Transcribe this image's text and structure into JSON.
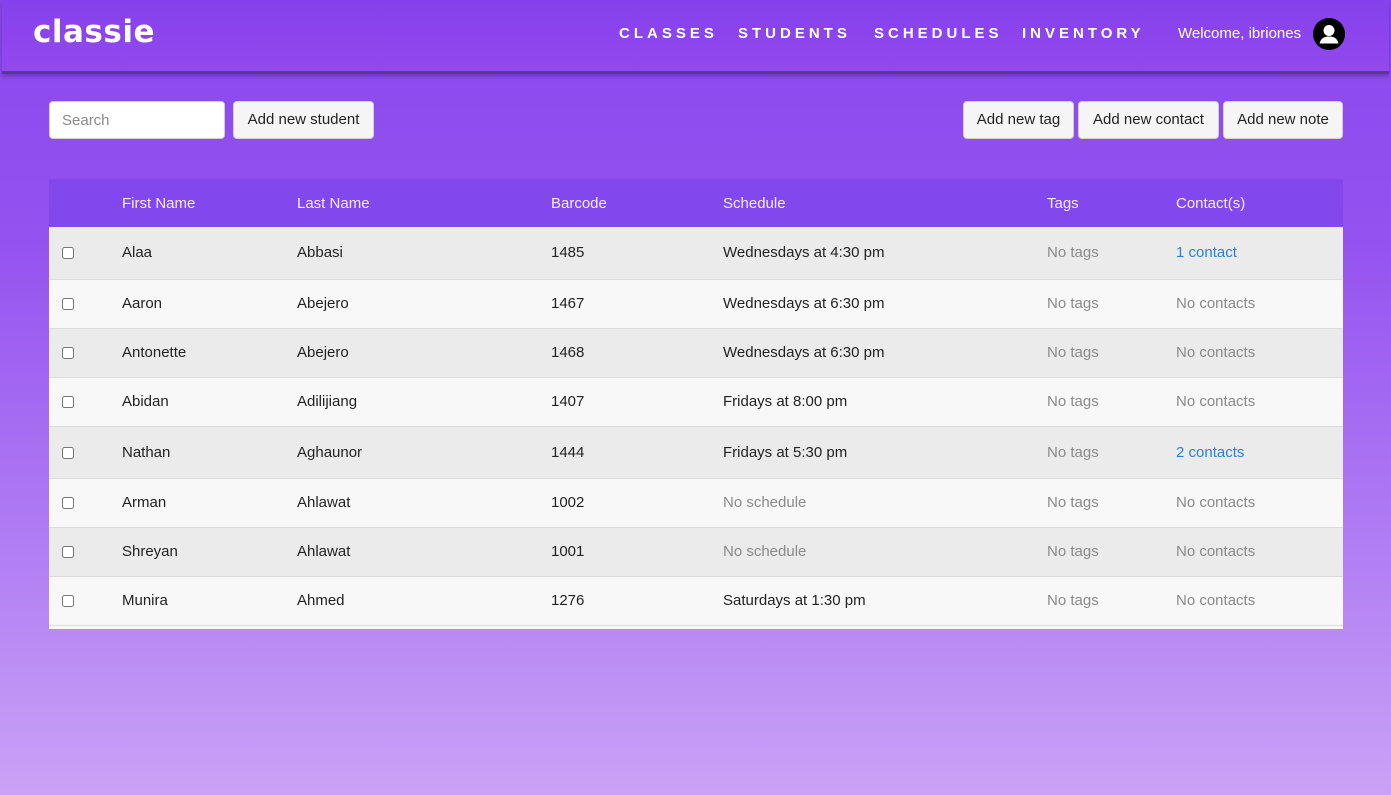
{
  "app": {
    "brand": "classie"
  },
  "nav": {
    "links": [
      "CLASSES",
      "STUDENTS",
      "SCHEDULES",
      "INVENTORY"
    ],
    "welcome": "Welcome, ibriones",
    "avatar_icon": "user-icon"
  },
  "toolbar": {
    "search_placeholder": "Search",
    "add_student_label": "Add new student",
    "add_tag_label": "Add new tag",
    "add_contact_label": "Add new contact",
    "add_note_label": "Add new note"
  },
  "table": {
    "headers": {
      "first_name": "First Name",
      "last_name": "Last Name",
      "barcode": "Barcode",
      "schedule": "Schedule",
      "tags": "Tags",
      "contacts": "Contact(s)"
    },
    "rows": [
      {
        "first": "Alaa",
        "last": "Abbasi",
        "barcode": "1485",
        "schedule": "Wednesdays at 4:30 pm",
        "tags": "No tags",
        "contacts": "1 contact",
        "contacts_link": true,
        "schedule_muted": false
      },
      {
        "first": "Aaron",
        "last": "Abejero",
        "barcode": "1467",
        "schedule": "Wednesdays at 6:30 pm",
        "tags": "No tags",
        "contacts": "No contacts",
        "contacts_link": false,
        "schedule_muted": false
      },
      {
        "first": "Antonette",
        "last": "Abejero",
        "barcode": "1468",
        "schedule": "Wednesdays at 6:30 pm",
        "tags": "No tags",
        "contacts": "No contacts",
        "contacts_link": false,
        "schedule_muted": false
      },
      {
        "first": "Abidan",
        "last": "Adilijiang",
        "barcode": "1407",
        "schedule": "Fridays at 8:00 pm",
        "tags": "No tags",
        "contacts": "No contacts",
        "contacts_link": false,
        "schedule_muted": false
      },
      {
        "first": "Nathan",
        "last": "Aghaunor",
        "barcode": "1444",
        "schedule": "Fridays at 5:30 pm",
        "tags": "No tags",
        "contacts": "2 contacts",
        "contacts_link": true,
        "schedule_muted": false
      },
      {
        "first": "Arman",
        "last": "Ahlawat",
        "barcode": "1002",
        "schedule": "No schedule",
        "tags": "No tags",
        "contacts": "No contacts",
        "contacts_link": false,
        "schedule_muted": true
      },
      {
        "first": "Shreyan",
        "last": "Ahlawat",
        "barcode": "1001",
        "schedule": "No schedule",
        "tags": "No tags",
        "contacts": "No contacts",
        "contacts_link": false,
        "schedule_muted": true
      },
      {
        "first": "Munira",
        "last": "Ahmed",
        "barcode": "1276",
        "schedule": "Saturdays at 1:30 pm",
        "tags": "No tags",
        "contacts": "No contacts",
        "contacts_link": false,
        "schedule_muted": false
      }
    ]
  },
  "colors": {
    "header_purple": "#8248ee",
    "link_blue": "#2f7fd4",
    "muted_gray": "#8a8a8a"
  }
}
